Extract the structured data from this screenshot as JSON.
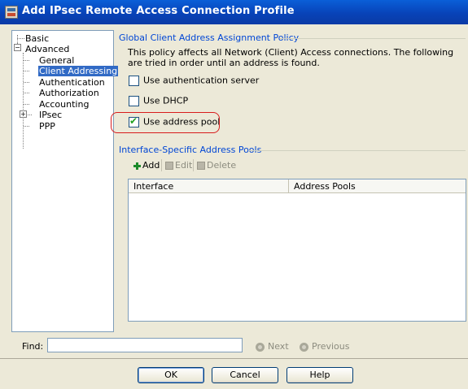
{
  "window": {
    "title": "Add IPsec Remote Access Connection Profile"
  },
  "tree": {
    "items": [
      {
        "label": "Basic"
      },
      {
        "label": "Advanced"
      },
      {
        "label": "General"
      },
      {
        "label": "Client Addressing"
      },
      {
        "label": "Authentication"
      },
      {
        "label": "Authorization"
      },
      {
        "label": "Accounting"
      },
      {
        "label": "IPsec"
      },
      {
        "label": "PPP"
      }
    ],
    "selected": "Client Addressing"
  },
  "global_policy": {
    "group_title": "Global Client Address Assignment Policy",
    "description": "This policy affects all Network (Client) Access connections. The following are tried in order until an address is found.",
    "options": [
      {
        "label": "Use authentication server",
        "checked": false
      },
      {
        "label": "Use DHCP",
        "checked": false
      },
      {
        "label": "Use address pool",
        "checked": true
      }
    ]
  },
  "interface_pools": {
    "group_title": "Interface-Specific Address Pools",
    "toolbar": {
      "add_label": "Add",
      "edit_label": "Edit",
      "delete_label": "Delete"
    },
    "table": {
      "columns": [
        "Interface",
        "Address Pools"
      ],
      "rows": []
    }
  },
  "find": {
    "label": "Find:",
    "value": "",
    "next_label": "Next",
    "previous_label": "Previous"
  },
  "buttons": {
    "ok_label": "OK",
    "cancel_label": "Cancel",
    "help_label": "Help"
  },
  "colors": {
    "title_bar": "#0843b8",
    "group_title": "#0046d5",
    "selection": "#316ac5",
    "highlight_oval": "#d81c1c",
    "checkmark": "#21a121"
  }
}
